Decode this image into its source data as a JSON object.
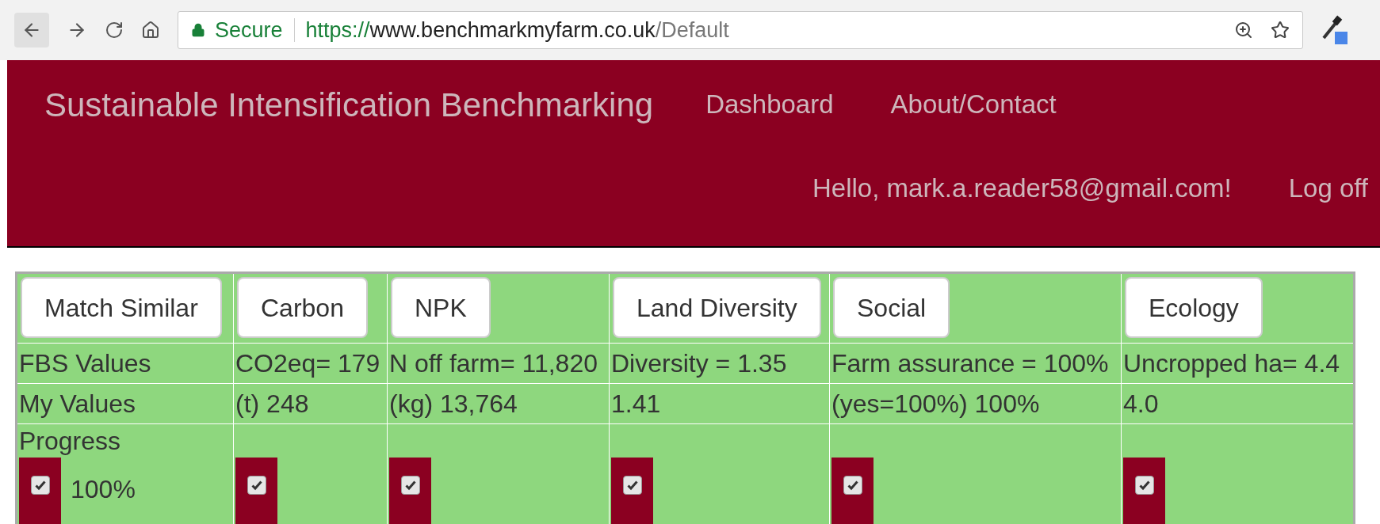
{
  "browser": {
    "secure_label": "Secure",
    "url_scheme": "https://",
    "url_domain": "www.benchmarkmyfarm.co.uk",
    "url_path": "/Default"
  },
  "header": {
    "title": "Sustainable Intensification Benchmarking",
    "nav": [
      {
        "label": "Dashboard"
      },
      {
        "label": "About/Contact"
      }
    ],
    "greeting": "Hello, mark.a.reader58@gmail.com!",
    "logoff": "Log off"
  },
  "table": {
    "columns": [
      {
        "button": "Match Similar",
        "fbs": "FBS Values",
        "mine": "My Values",
        "progress_label": "Progress",
        "checked": true,
        "progress_text": "100%"
      },
      {
        "button": "Carbon",
        "fbs": "CO2eq= 179",
        "mine": "(t) 248",
        "checked": true
      },
      {
        "button": "NPK",
        "fbs": "N off farm= 11,820",
        "mine": "(kg) 13,764",
        "checked": true
      },
      {
        "button": "Land Diversity",
        "fbs": "Diversity = 1.35",
        "mine": "1.41",
        "checked": true
      },
      {
        "button": "Social",
        "fbs": "Farm assurance = 100%",
        "mine": "(yes=100%) 100%",
        "checked": true
      },
      {
        "button": "Ecology",
        "fbs": "Uncropped ha= 4.4",
        "mine": "4.0",
        "checked": true
      }
    ]
  }
}
